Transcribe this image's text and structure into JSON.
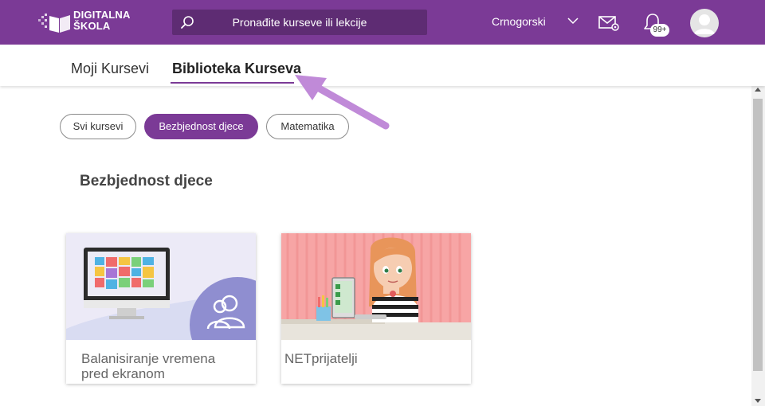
{
  "header": {
    "logo_text_line1": "DIGITALNA",
    "logo_text_line2": "ŠKOLA",
    "search_placeholder": "Pronađite kurseve ili lekcije",
    "language": "Crnogorski",
    "notification_count": "99+"
  },
  "tabs": [
    {
      "label": "Moji Kursevi",
      "active": false
    },
    {
      "label": "Biblioteka Kurseva",
      "active": true
    }
  ],
  "filters": [
    {
      "label": "Svi kursevi",
      "selected": false
    },
    {
      "label": "Bezbjednost djece",
      "selected": true
    },
    {
      "label": "Matematika",
      "selected": false
    }
  ],
  "section": {
    "title": "Bezbjednost djece"
  },
  "cards": [
    {
      "title": "Balanisiranje vremena pred ekranom",
      "image": "monitor-illustration"
    },
    {
      "title": "NETprijatelji",
      "image": "girl-with-laptop-illustration"
    }
  ],
  "colors": {
    "brand_purple": "#7b3a96",
    "search_bg": "#5e2c73",
    "annotation_arrow": "#c08ad8"
  }
}
